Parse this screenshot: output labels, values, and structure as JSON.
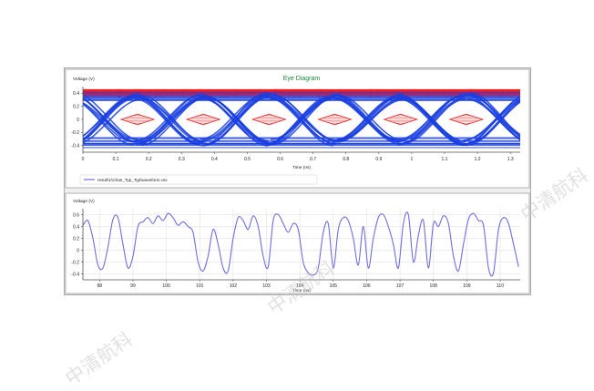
{
  "colors": {
    "eye_blue": "#1a3fe0",
    "eye_red": "#ff1a1a",
    "mask_red": "#e03030",
    "wave": "#6e6ee0",
    "title_green": "#1c8a3c",
    "axis": "#505050"
  },
  "top_chart": {
    "title": "Eye Diagram",
    "ylabel": "Voltage (V)",
    "xlabel": "Time (ns)",
    "legend_entry": "result\\1\\Chan_Typ_Typ\\waveform.csv",
    "legend_icon": "line-sample-icon"
  },
  "bottom_chart": {
    "ylabel": "Voltage (V)",
    "xlabel": "Time (ns)"
  },
  "watermarks": [
    "中清航科",
    "中清航科",
    "中清航科"
  ],
  "chart_data": [
    {
      "type": "line",
      "title": "Eye Diagram",
      "xlabel": "Time (ns)",
      "ylabel": "Voltage (V)",
      "xlim": [
        0,
        1.33
      ],
      "ylim": [
        -0.5,
        0.5
      ],
      "x_ticks": [
        "0",
        "0.1",
        "0.2",
        "0.3",
        "0.4",
        "0.5",
        "0.6",
        "0.7",
        "0.8",
        "0.9",
        "1",
        "1.1",
        "1.2",
        "1.3"
      ],
      "y_ticks": [
        "0.4",
        "0.2",
        "0",
        "-0.2",
        "-0.4"
      ],
      "unit_interval": 0.2,
      "eye_crossings": [
        0.066,
        0.266,
        0.466,
        0.666,
        0.866,
        1.066,
        1.266
      ],
      "eye_centers": [
        0.166,
        0.366,
        0.566,
        0.766,
        0.966,
        1.166
      ],
      "level_high": 0.35,
      "level_low": -0.35,
      "overshoot_high": 0.46,
      "overshoot_low": -0.46,
      "mask_diamonds": [
        {
          "center": 0.1,
          "half_width": 0.05,
          "half_height": 0.08
        },
        {
          "center": 0.3,
          "half_width": 0.05,
          "half_height": 0.08
        },
        {
          "center": 0.5,
          "half_width": 0.05,
          "half_height": 0.08
        },
        {
          "center": 0.7,
          "half_width": 0.05,
          "half_height": 0.08
        },
        {
          "center": 0.9,
          "half_width": 0.05,
          "half_height": 0.08
        },
        {
          "center": 1.1,
          "half_width": 0.05,
          "half_height": 0.08
        },
        {
          "center": 1.3,
          "half_width": 0.05,
          "half_height": 0.08
        }
      ],
      "series": [
        {
          "values": "overlaid waveform traces",
          "color": "#1a3fe0"
        }
      ]
    },
    {
      "type": "line",
      "xlabel": "Time (ns)",
      "ylabel": "Voltage (V)",
      "xlim": [
        97.5,
        110.6
      ],
      "ylim": [
        -0.5,
        0.7
      ],
      "x_ticks": [
        "98",
        "99",
        "100",
        "101",
        "102",
        "103",
        "104",
        "105",
        "106",
        "107",
        "108",
        "109",
        "110"
      ],
      "y_ticks": [
        "0.6",
        "0.4",
        "0.2",
        "0",
        "-0.2",
        "-0.4"
      ],
      "x": [
        97.5,
        97.65,
        97.8,
        97.95,
        98.1,
        98.25,
        98.4,
        98.55,
        98.7,
        98.85,
        99.0,
        99.15,
        99.3,
        99.45,
        99.6,
        99.75,
        99.9,
        100.05,
        100.2,
        100.35,
        100.5,
        100.65,
        100.8,
        100.95,
        101.1,
        101.25,
        101.4,
        101.55,
        101.7,
        101.85,
        102.0,
        102.15,
        102.3,
        102.45,
        102.6,
        102.75,
        102.9,
        103.05,
        103.2,
        103.35,
        103.5,
        103.65,
        103.8,
        103.95,
        104.1,
        104.25,
        104.4,
        104.55,
        104.7,
        104.85,
        105.0,
        105.15,
        105.3,
        105.45,
        105.6,
        105.75,
        105.9,
        106.05,
        106.2,
        106.35,
        106.5,
        106.65,
        106.8,
        106.95,
        107.1,
        107.25,
        107.4,
        107.55,
        107.7,
        107.85,
        108.0,
        108.15,
        108.3,
        108.45,
        108.6,
        108.75,
        108.9,
        109.05,
        109.2,
        109.35,
        109.5,
        109.65,
        109.8,
        109.95,
        110.1,
        110.25,
        110.4,
        110.55
      ],
      "series": [
        {
          "values": [
            0.42,
            0.5,
            0.2,
            -0.25,
            -0.3,
            0.05,
            0.52,
            0.55,
            0.1,
            -0.3,
            -0.1,
            0.4,
            0.48,
            0.55,
            0.45,
            0.58,
            0.5,
            0.62,
            0.55,
            0.42,
            0.48,
            0.4,
            0.3,
            -0.2,
            -0.35,
            -0.1,
            0.35,
            0.1,
            -0.3,
            -0.35,
            0.2,
            0.55,
            0.5,
            0.35,
            0.58,
            0.4,
            -0.1,
            -0.28,
            0.5,
            0.6,
            0.45,
            0.3,
            0.45,
            0.35,
            -0.2,
            -0.38,
            -0.42,
            -0.3,
            0.3,
            0.45,
            -0.3,
            0.35,
            0.55,
            0.5,
            0.2,
            -0.25,
            0.4,
            -0.3,
            0.2,
            0.55,
            0.6,
            0.4,
            0.1,
            -0.3,
            0.45,
            0.6,
            -0.2,
            0.25,
            0.5,
            -0.3,
            0.45,
            0.4,
            0.58,
            0.45,
            -0.1,
            -0.35,
            0.1,
            0.52,
            0.62,
            0.5,
            0.42,
            -0.3,
            -0.38,
            0.35,
            0.55,
            0.45,
            0.1,
            -0.28
          ],
          "color": "#6e6ee0"
        }
      ]
    }
  ]
}
